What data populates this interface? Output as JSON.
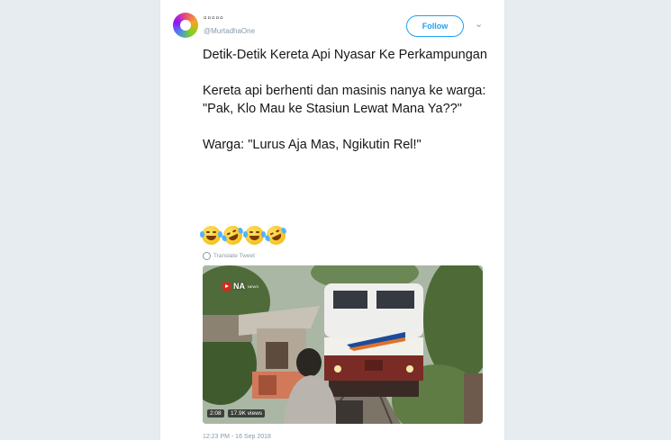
{
  "tweet": {
    "display_name": "▫▫▫▫▫",
    "handle": "@MurtadhaOne",
    "follow_label": "Follow",
    "chevron": "⌄",
    "lines": [
      "Detik-Detik Kereta Api Nyasar Ke Perkampungan",
      "Kereta api berhenti dan masinis nanya ke warga:",
      "\"Pak, Klo Mau ke Stasiun Lewat Mana Ya??\"",
      "Warga: \"Lurus Aja Mas, Ngikutin Rel!\""
    ],
    "emojis": [
      "face-with-tears-of-joy",
      "rolling-on-the-floor-laughing",
      "face-with-tears-of-joy",
      "rolling-on-the-floor-laughing"
    ],
    "translate_label": "Translate Tweet",
    "video": {
      "channel_logo": "NA",
      "channel_sub": "NEWS",
      "duration": "2:08",
      "views": "17.9K views"
    },
    "timestamp": "12:23 PM - 16 Sep 2018"
  }
}
